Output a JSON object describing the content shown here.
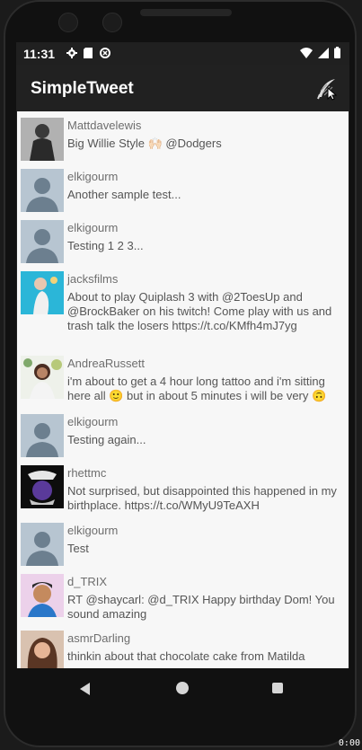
{
  "status": {
    "time": "11:31"
  },
  "app": {
    "title": "SimpleTweet"
  },
  "tweets": [
    {
      "user": "Mattdavelewis",
      "text": "Big Willie Style 🙌🏻 @Dodgers",
      "avatar": "photo"
    },
    {
      "user": "elkigourm",
      "text": "Another sample test...",
      "avatar": "default"
    },
    {
      "user": "elkigourm",
      "text": "Testing 1 2 3...",
      "avatar": "default"
    },
    {
      "user": "jacksfilms",
      "text": "About to play Quiplash 3 with @2ToesUp and @BrockBaker on his twitch! Come play with us and trash talk the losers https://t.co/KMfh4mJ7yg",
      "avatar": "photo"
    },
    {
      "user": "AndreaRussett",
      "text": "i'm about to get a 4 hour long tattoo  and i'm sitting here all 🙂 but in about 5 minutes i will be very 🙃",
      "avatar": "photo"
    },
    {
      "user": "elkigourm",
      "text": "Testing again...",
      "avatar": "default"
    },
    {
      "user": "rhettmc",
      "text": "Not surprised, but disappointed this happened in my birthplace. https://t.co/WMyU9TeAXH",
      "avatar": "photo"
    },
    {
      "user": "elkigourm",
      "text": "Test",
      "avatar": "default"
    },
    {
      "user": "d_TRIX",
      "text": "RT @shaycarl: @d_TRIX Happy birthday Dom! You sound amazing",
      "avatar": "photo"
    },
    {
      "user": "asmrDarling",
      "text": "thinkin about that chocolate cake from Matilda",
      "avatar": "photo"
    }
  ],
  "corner_label": "0:00"
}
